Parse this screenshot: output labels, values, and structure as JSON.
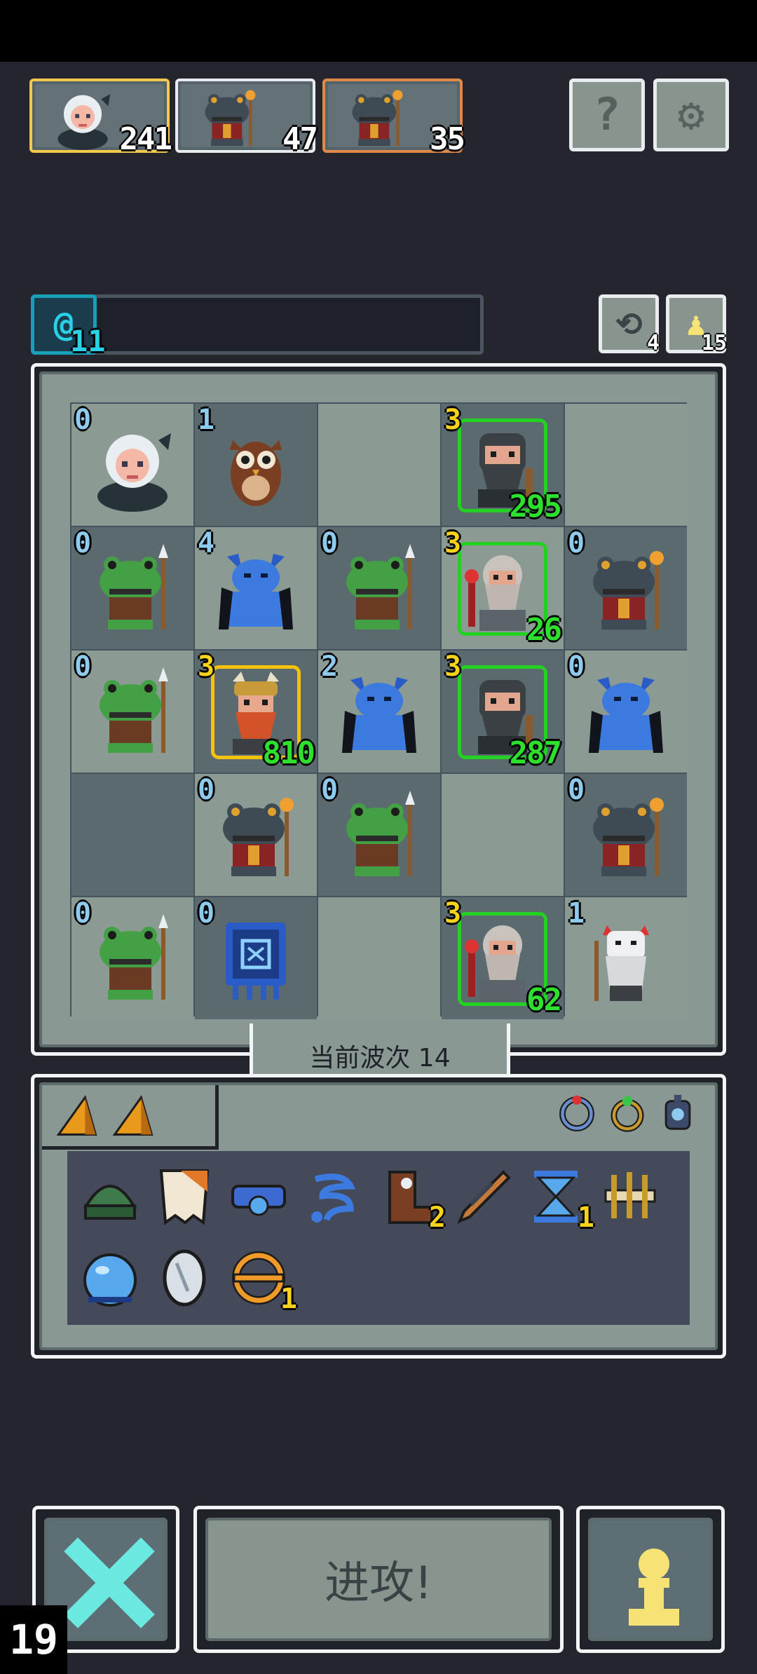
{
  "header": {
    "portraits": [
      {
        "name": "white-haired-heroine",
        "count": "241",
        "border": "#f2c94c"
      },
      {
        "name": "toad-shaman",
        "count": "47",
        "border": "#e8ecef"
      },
      {
        "name": "toad-shaman",
        "count": "35",
        "border": "#e08a4a"
      }
    ],
    "help_label": "?",
    "settings_label": "⚙"
  },
  "resources": {
    "orb_count": "11",
    "refresh_count": "4",
    "pawn_count": "15"
  },
  "board": {
    "cells": [
      {
        "lvl": "0",
        "lvlColor": "#8ec9ee",
        "unit": "white-haired-heroine",
        "hp": "",
        "glow": ""
      },
      {
        "lvl": "1",
        "lvlColor": "#8ec9ee",
        "unit": "owl",
        "hp": "",
        "glow": ""
      },
      {
        "lvl": "",
        "lvlColor": "",
        "unit": "",
        "hp": "",
        "glow": ""
      },
      {
        "lvl": "3",
        "lvlColor": "#f7d21a",
        "unit": "dwarf-warrior",
        "hp": "295",
        "glow": "green"
      },
      {
        "lvl": "",
        "lvlColor": "",
        "unit": "",
        "hp": "",
        "glow": ""
      },
      {
        "lvl": "0",
        "lvlColor": "#8ec9ee",
        "unit": "green-frog-spearman",
        "hp": "",
        "glow": ""
      },
      {
        "lvl": "4",
        "lvlColor": "#8ec9ee",
        "unit": "blue-imp",
        "hp": "",
        "glow": ""
      },
      {
        "lvl": "0",
        "lvlColor": "#8ec9ee",
        "unit": "green-frog-spearman",
        "hp": "",
        "glow": ""
      },
      {
        "lvl": "3",
        "lvlColor": "#f7d21a",
        "unit": "old-dwarf-mage",
        "hp": "26",
        "glow": "green"
      },
      {
        "lvl": "0",
        "lvlColor": "#8ec9ee",
        "unit": "toad-shaman",
        "hp": "",
        "glow": ""
      },
      {
        "lvl": "0",
        "lvlColor": "#8ec9ee",
        "unit": "green-frog-spearman",
        "hp": "",
        "glow": ""
      },
      {
        "lvl": "3",
        "lvlColor": "#f7d21a",
        "unit": "red-beard-dwarf",
        "hp": "810",
        "glow": "gold"
      },
      {
        "lvl": "2",
        "lvlColor": "#8ec9ee",
        "unit": "blue-imp",
        "hp": "",
        "glow": ""
      },
      {
        "lvl": "3",
        "lvlColor": "#f7d21a",
        "unit": "dwarf-warrior",
        "hp": "287",
        "glow": "green"
      },
      {
        "lvl": "0",
        "lvlColor": "#8ec9ee",
        "unit": "blue-imp",
        "hp": "",
        "glow": ""
      },
      {
        "lvl": "",
        "lvlColor": "",
        "unit": "",
        "hp": "",
        "glow": ""
      },
      {
        "lvl": "0",
        "lvlColor": "#8ec9ee",
        "unit": "toad-shaman",
        "hp": "",
        "glow": ""
      },
      {
        "lvl": "0",
        "lvlColor": "#8ec9ee",
        "unit": "green-frog-spearman",
        "hp": "",
        "glow": ""
      },
      {
        "lvl": "",
        "lvlColor": "",
        "unit": "",
        "hp": "",
        "glow": ""
      },
      {
        "lvl": "0",
        "lvlColor": "#8ec9ee",
        "unit": "toad-shaman",
        "hp": "",
        "glow": ""
      },
      {
        "lvl": "0",
        "lvlColor": "#8ec9ee",
        "unit": "green-frog-spearman",
        "hp": "",
        "glow": ""
      },
      {
        "lvl": "0",
        "lvlColor": "#8ec9ee",
        "unit": "blue-banner",
        "hp": "",
        "glow": ""
      },
      {
        "lvl": "",
        "lvlColor": "",
        "unit": "",
        "hp": "",
        "glow": ""
      },
      {
        "lvl": "3",
        "lvlColor": "#f7d21a",
        "unit": "old-dwarf-mage",
        "hp": "62",
        "glow": "green"
      },
      {
        "lvl": "1",
        "lvlColor": "#8ec9ee",
        "unit": "white-oni-sage",
        "hp": "",
        "glow": ""
      }
    ]
  },
  "wave": {
    "label": "当前波次 14"
  },
  "inventory": {
    "tab_items": [
      "orange-gem",
      "orange-gem"
    ],
    "rings": [
      "red-ring",
      "green-ring",
      "blue-amulet"
    ],
    "items": [
      {
        "name": "green-helmet",
        "count": ""
      },
      {
        "name": "tattered-cape",
        "count": ""
      },
      {
        "name": "blue-belt",
        "count": ""
      },
      {
        "name": "blue-wind-scroll",
        "count": ""
      },
      {
        "name": "brown-boot",
        "count": "2"
      },
      {
        "name": "feather-dagger",
        "count": ""
      },
      {
        "name": "hourglass",
        "count": "1"
      },
      {
        "name": "bone-claw",
        "count": ""
      },
      {
        "name": "water-orb",
        "count": ""
      },
      {
        "name": "mirror-stone",
        "count": ""
      },
      {
        "name": "compass-ring",
        "count": "1"
      }
    ]
  },
  "footer": {
    "cancel_label": "✕",
    "attack_label": "进攻!",
    "pawn_label": "♟",
    "fps": "19"
  },
  "colors": {
    "accent_green": "#2ee02e",
    "accent_gold": "#f7d21a",
    "accent_cyan": "#2ad0e6"
  }
}
